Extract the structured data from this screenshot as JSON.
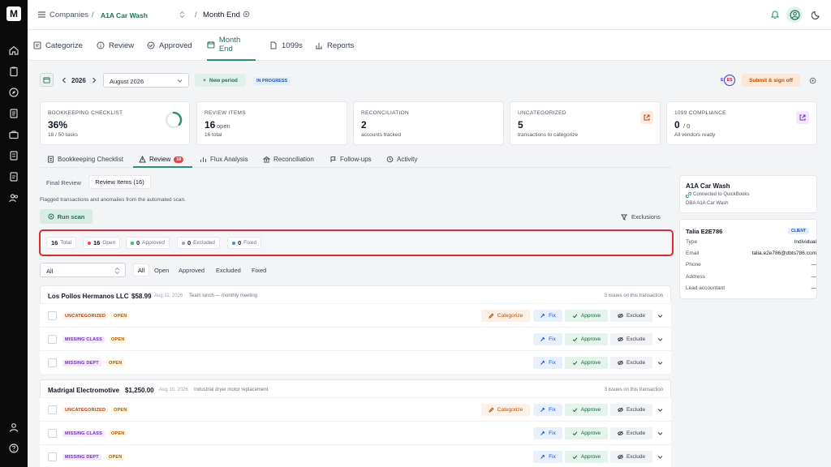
{
  "header": {
    "companies_label": "Companies",
    "separator": "/",
    "company_name": "A1A Car Wash",
    "period_label": "Month End"
  },
  "nav": {
    "tabs": [
      {
        "label": "Categorize"
      },
      {
        "label": "Review"
      },
      {
        "label": "Approved"
      },
      {
        "label": "Month End"
      },
      {
        "label": "1099s"
      },
      {
        "label": "Reports"
      }
    ]
  },
  "period": {
    "year": "2026",
    "month": "August 2026",
    "new_period_label": "New period",
    "status_badge": "IN PROGRESS",
    "avatar_initials_1": "E",
    "avatar_initials_2": "ES",
    "signoff_label": "Submit & sign off"
  },
  "stats": [
    {
      "caption": "BOOKKEEPING CHECKLIST",
      "value": "36%",
      "sub": "18 / 50 tasks",
      "progress": 0.36
    },
    {
      "caption": "REVIEW ITEMS",
      "value": "16",
      "value_suffix": "open",
      "sub": "16 total"
    },
    {
      "caption": "RECONCILIATION",
      "value": "2",
      "sub": "accounts tracked"
    },
    {
      "caption": "UNCATEGORIZED",
      "value": "5",
      "sub": "transactions to categorize"
    },
    {
      "caption": "1099 COMPLIANCE",
      "value": "0",
      "value_suffix": "/ 0",
      "sub": "All vendors ready"
    }
  ],
  "subtabs": [
    {
      "label": "Bookkeeping Checklist"
    },
    {
      "label": "Review",
      "badge": "16"
    },
    {
      "label": "Flux Analysis"
    },
    {
      "label": "Reconciliation"
    },
    {
      "label": "Follow-ups"
    },
    {
      "label": "Activity"
    }
  ],
  "review": {
    "segments": [
      {
        "label": "Final Review"
      },
      {
        "label": "Review Items (16)"
      }
    ],
    "description": "Flagged transactions and anomalies from the automated scan.",
    "run_scan_label": "Run scan",
    "exclusions_label": "Exclusions",
    "summary": [
      {
        "count": "16",
        "label": "Total",
        "color": ""
      },
      {
        "count": "16",
        "label": "Open",
        "color": "#ef4444"
      },
      {
        "count": "0",
        "label": "Approved",
        "color": "#22c55e"
      },
      {
        "count": "0",
        "label": "Excluded",
        "color": "#9ca3af"
      },
      {
        "count": "0",
        "label": "Fixed",
        "color": "#3b82f6"
      }
    ],
    "filter_select": "All",
    "filters": [
      {
        "label": "All"
      },
      {
        "label": "Open"
      },
      {
        "label": "Approved"
      },
      {
        "label": "Excluded"
      },
      {
        "label": "Fixed"
      }
    ]
  },
  "transactions": [
    {
      "vendor": "Los Pollos Hermanos LLC",
      "amount": "$58.99",
      "date": "Aug 11, 2026",
      "memo": "Team lunch — monthly meeting",
      "issues": "3 issues on this transaction",
      "rows": [
        {
          "tag": "UNCATEGORIZED",
          "status": "OPEN",
          "categorize": "Categorize"
        },
        {
          "tag": "MISSING CLASS",
          "status": "OPEN"
        },
        {
          "tag": "MISSING DEPT",
          "status": "OPEN"
        }
      ]
    },
    {
      "vendor": "Madrigal Electromotive",
      "amount": "$1,250.00",
      "date": "Aug 10, 2026",
      "memo": "Industrial dryer motor replacement",
      "issues": "3 issues on this transaction",
      "rows": [
        {
          "tag": "UNCATEGORIZED",
          "status": "OPEN",
          "categorize": "Categorize"
        },
        {
          "tag": "MISSING CLASS",
          "status": "OPEN"
        },
        {
          "tag": "MISSING DEPT",
          "status": "OPEN"
        }
      ]
    }
  ],
  "actions": {
    "fix": "Fix",
    "approve": "Approve",
    "exclude": "Exclude"
  },
  "company_panel": {
    "name": "A1A Car Wash",
    "connection": "Connected to QuickBooks",
    "dba": "DBA A1A Car Wash"
  },
  "client_panel": {
    "name": "Talia E2E786",
    "badge": "CLIENT",
    "fields": [
      {
        "label": "Type",
        "value": "Individual"
      },
      {
        "label": "Email",
        "value": "talia.e2e786@dbts786.com"
      },
      {
        "label": "Phone",
        "value": "—"
      },
      {
        "label": "Address",
        "value": "—"
      },
      {
        "label": "Lead accountant",
        "value": "—"
      }
    ]
  },
  "colors": {
    "accent": "#2f8f74",
    "highlight_border": "#d92d2d"
  }
}
